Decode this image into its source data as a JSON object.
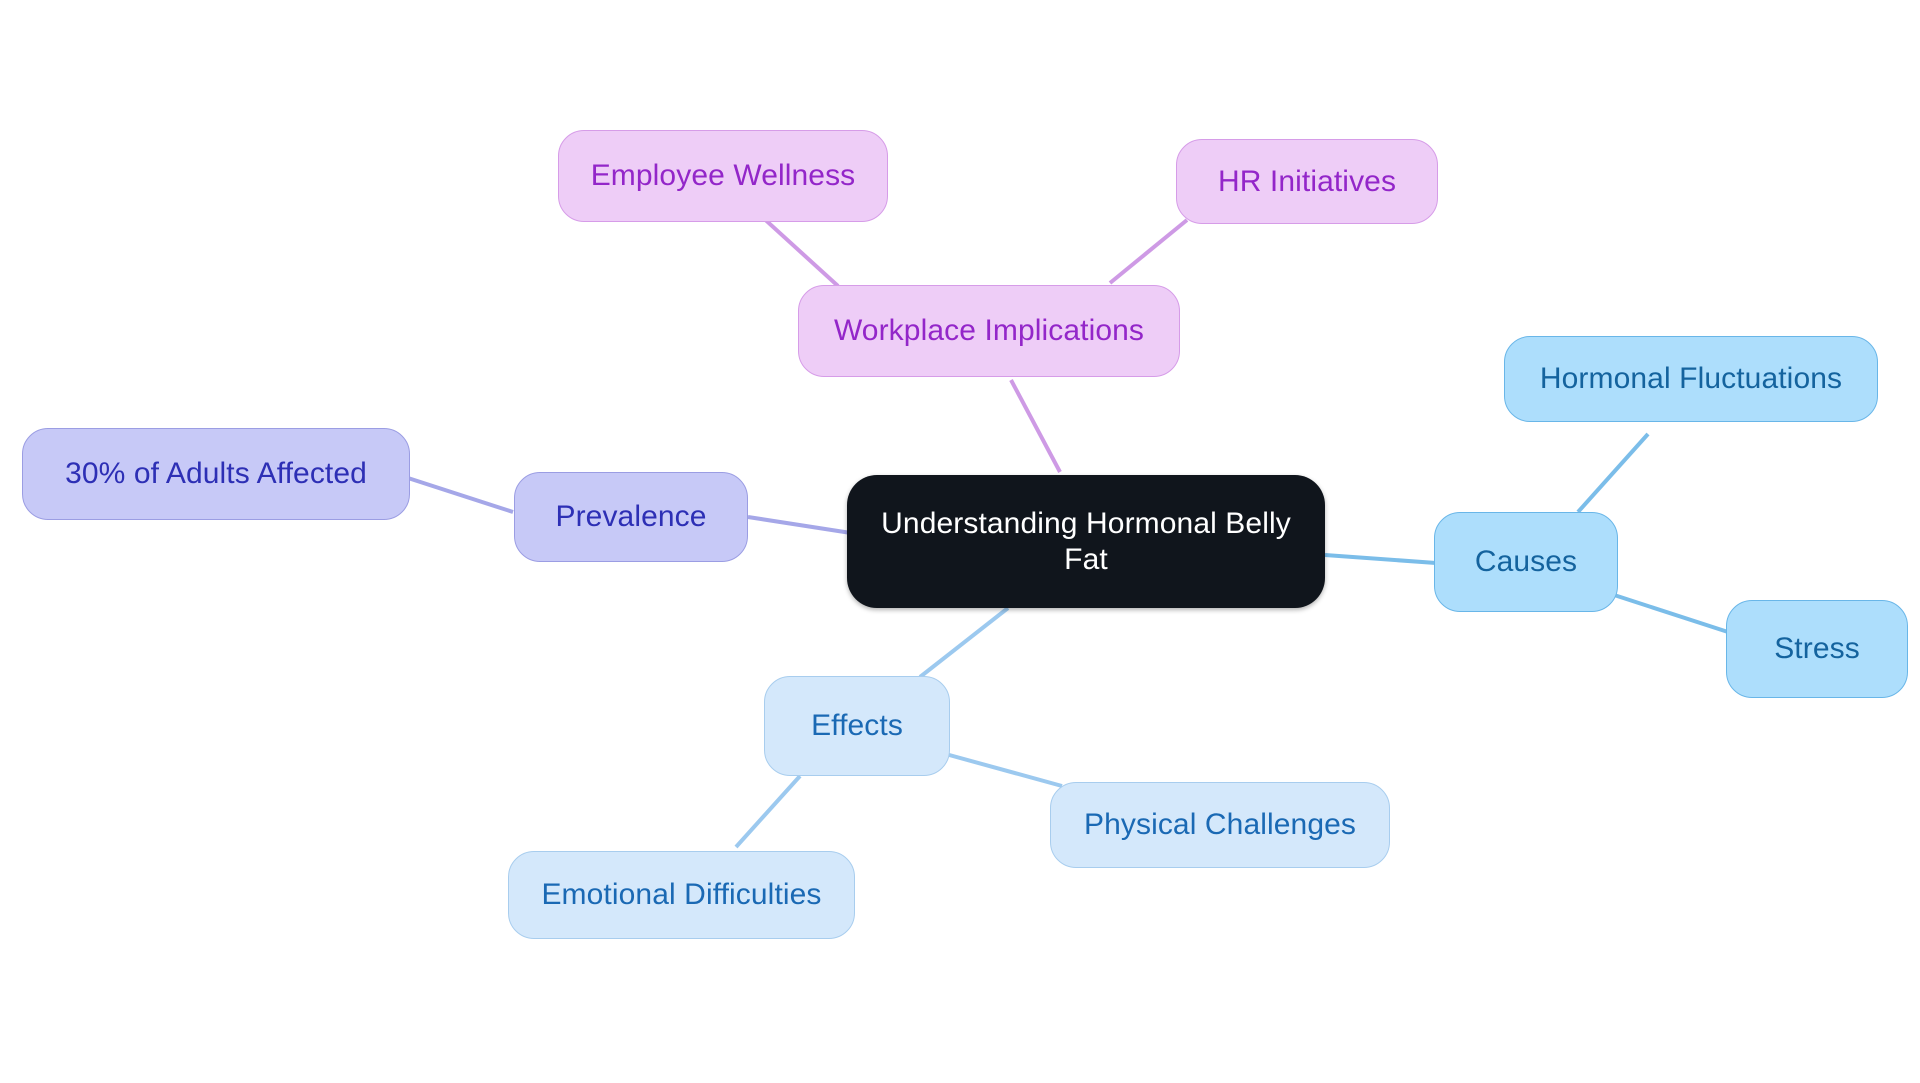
{
  "diagram": {
    "type": "mindmap",
    "title": "Understanding Hormonal Belly Fat",
    "background": "#ffffff",
    "root": {
      "id": "root",
      "label": "Understanding Hormonal Belly\nFat",
      "fill": "#10151c",
      "text_color": "#ffffff"
    },
    "nodes": [
      {
        "id": "causes",
        "label": "Causes",
        "branch": "causes",
        "level": 1,
        "fill": "#addefc",
        "stroke": "#69b6e8",
        "text_color": "#14639e"
      },
      {
        "id": "hormonal-fluctuations",
        "label": "Hormonal Fluctuations",
        "branch": "causes",
        "level": 2,
        "fill": "#addefc",
        "stroke": "#69b6e8",
        "text_color": "#14639e"
      },
      {
        "id": "stress",
        "label": "Stress",
        "branch": "causes",
        "level": 2,
        "fill": "#addefc",
        "stroke": "#69b6e8",
        "text_color": "#14639e"
      },
      {
        "id": "effects",
        "label": "Effects",
        "branch": "effects",
        "level": 1,
        "fill": "#d4e8fb",
        "stroke": "#a8cdee",
        "text_color": "#1a69b4"
      },
      {
        "id": "physical-challenges",
        "label": "Physical Challenges",
        "branch": "effects",
        "level": 2,
        "fill": "#d4e8fb",
        "stroke": "#a8cdee",
        "text_color": "#1a69b4"
      },
      {
        "id": "emotional-difficulties",
        "label": "Emotional Difficulties",
        "branch": "effects",
        "level": 2,
        "fill": "#d4e8fb",
        "stroke": "#a8cdee",
        "text_color": "#1a69b4"
      },
      {
        "id": "prevalence",
        "label": "Prevalence",
        "branch": "prevalence",
        "level": 1,
        "fill": "#c7c9f7",
        "stroke": "#9b9de3",
        "text_color": "#2d2fb5"
      },
      {
        "id": "adults-affected",
        "label": "30% of Adults Affected",
        "branch": "prevalence",
        "level": 2,
        "fill": "#c7c9f7",
        "stroke": "#9b9de3",
        "text_color": "#2d2fb5"
      },
      {
        "id": "workplace-implications",
        "label": "Workplace Implications",
        "branch": "workplace",
        "level": 1,
        "fill": "#eecdf7",
        "stroke": "#d69ce8",
        "text_color": "#9326c9"
      },
      {
        "id": "employee-wellness",
        "label": "Employee Wellness",
        "branch": "workplace",
        "level": 2,
        "fill": "#eecdf7",
        "stroke": "#d69ce8",
        "text_color": "#9326c9"
      },
      {
        "id": "hr-initiatives",
        "label": "HR Initiatives",
        "branch": "workplace",
        "level": 2,
        "fill": "#eecdf7",
        "stroke": "#d69ce8",
        "text_color": "#9326c9"
      }
    ],
    "edges": [
      {
        "from": "root",
        "to": "causes",
        "color": "#7bbde9"
      },
      {
        "from": "causes",
        "to": "hormonal-fluctuations",
        "color": "#7bbde9"
      },
      {
        "from": "causes",
        "to": "stress",
        "color": "#7bbde9"
      },
      {
        "from": "root",
        "to": "effects",
        "color": "#9cc9ef"
      },
      {
        "from": "effects",
        "to": "physical-challenges",
        "color": "#9cc9ef"
      },
      {
        "from": "effects",
        "to": "emotional-difficulties",
        "color": "#9cc9ef"
      },
      {
        "from": "root",
        "to": "prevalence",
        "color": "#a5a7e8"
      },
      {
        "from": "prevalence",
        "to": "adults-affected",
        "color": "#a5a7e8"
      },
      {
        "from": "root",
        "to": "workplace-implications",
        "color": "#ce9ae5"
      },
      {
        "from": "workplace-implications",
        "to": "employee-wellness",
        "color": "#ce9ae5"
      },
      {
        "from": "workplace-implications",
        "to": "hr-initiatives",
        "color": "#ce9ae5"
      }
    ]
  }
}
